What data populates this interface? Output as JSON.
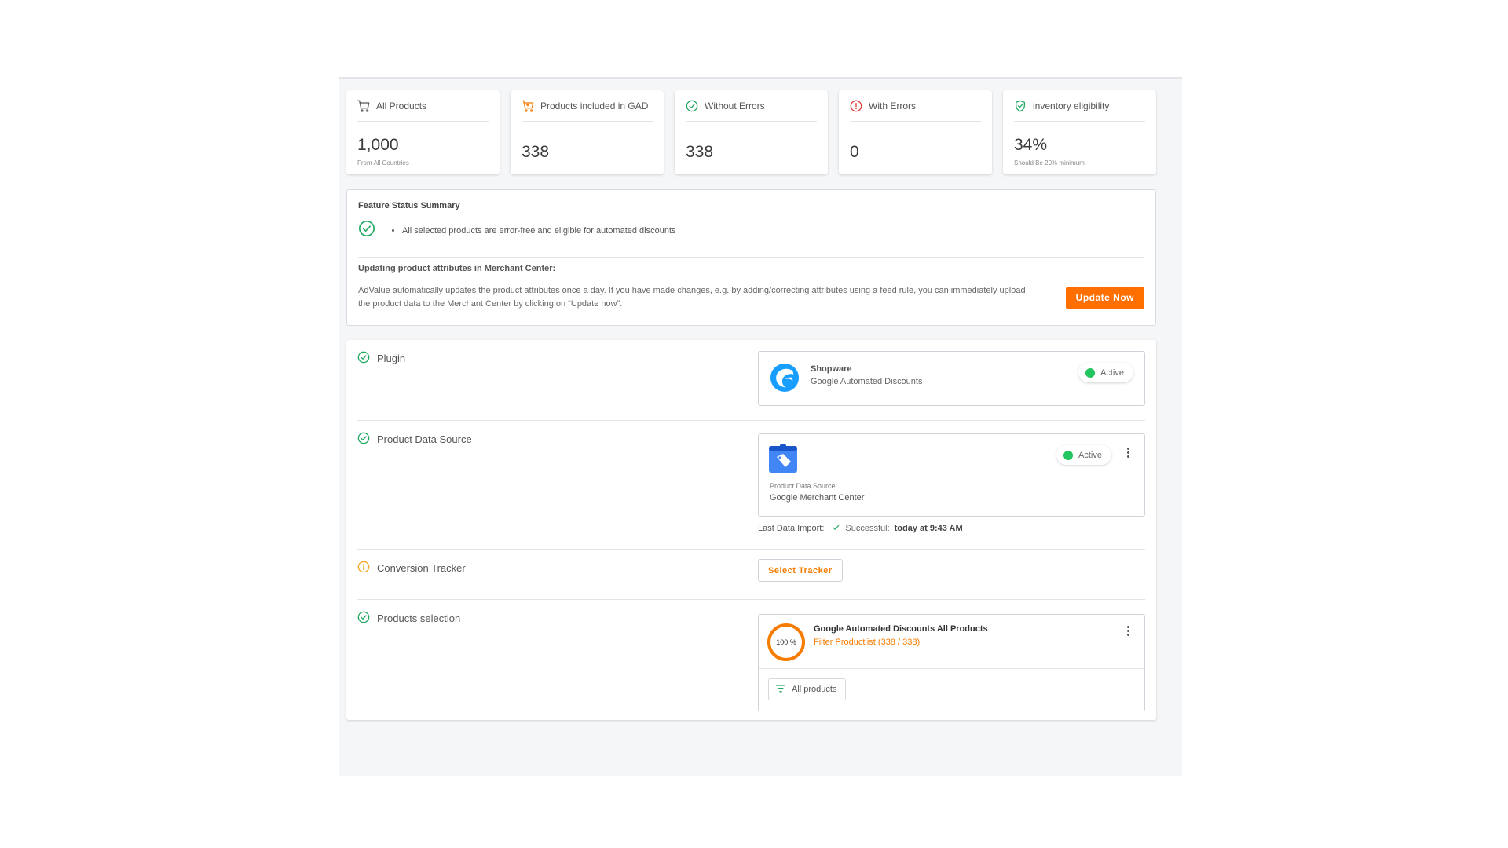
{
  "stats": [
    {
      "label": "All Products",
      "value": "1,000",
      "sub": "From All Countries",
      "icon": "cart-icon",
      "color": "#555555"
    },
    {
      "label": "Products included in GAD",
      "value": "338",
      "sub": "",
      "icon": "cart-icon",
      "color": "#f57c00"
    },
    {
      "label": "Without Errors",
      "value": "338",
      "sub": "",
      "icon": "check-circle-icon",
      "color": "#22a861"
    },
    {
      "label": "With Errors",
      "value": "0",
      "sub": "",
      "icon": "error-circle-icon",
      "color": "#e53935"
    },
    {
      "label": "inventory eligibility",
      "value": "34%",
      "sub": "Should Be 20% minimum",
      "icon": "shield-check-icon",
      "color": "#22a861"
    }
  ],
  "feature": {
    "title": "Feature Status Summary",
    "bullet": "All selected products are error-free and eligible for automated discounts",
    "update_title": "Updating product attributes in Merchant Center:",
    "update_text": "AdValue automatically updates the product attributes once a day. If you have made changes, e.g. by adding/correcting attributes using a feed rule, you can immediately upload the product data to the Merchant Center by clicking on “Update now”.",
    "update_button": "Update Now"
  },
  "setup": {
    "plugin": {
      "label": "Plugin",
      "name": "Shopware",
      "desc": "Google Automated Discounts",
      "status": "Active"
    },
    "data_source": {
      "label": "Product Data Source",
      "source_caption": "Product Data Source:",
      "source_name": "Google Merchant Center",
      "status": "Active",
      "import_label": "Last Data Import:",
      "import_status": "Successful:",
      "import_time": "today at 9:43 AM"
    },
    "tracker": {
      "label": "Conversion Tracker",
      "button": "Select Tracker"
    },
    "selection": {
      "label": "Products selection",
      "percent": "100 %",
      "percent_value": 1.0,
      "title": "Google Automated Discounts All Products",
      "filter": "Filter Productlist (338 / 338)",
      "chip": "All products"
    }
  },
  "colors": {
    "accent": "#ff6f00",
    "success": "#22c55e",
    "warning": "#f5a623",
    "error": "#e53935"
  }
}
